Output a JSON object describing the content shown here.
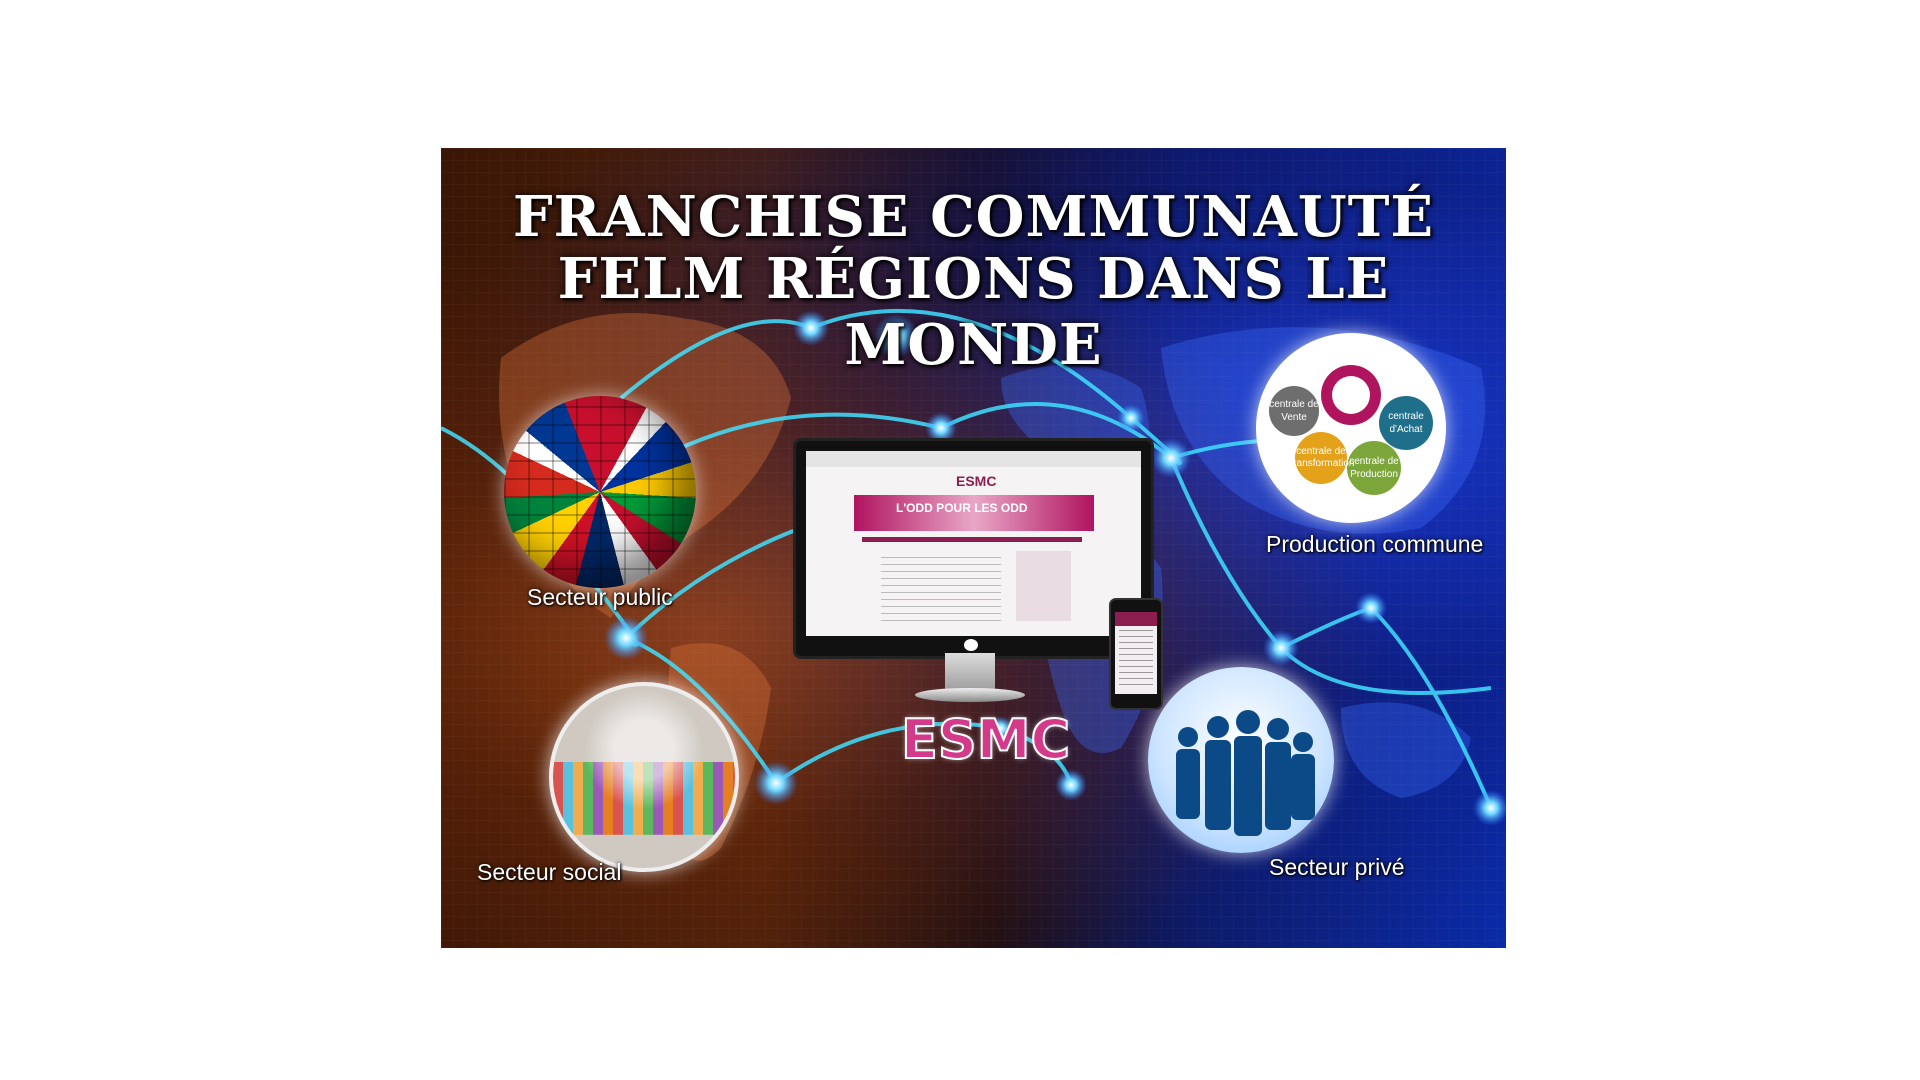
{
  "poster": {
    "title_line1": "FRANCHISE COMMUNAUTÉ",
    "title_line2": "FELM RÉGIONS DANS LE MONDE",
    "brand": "ESMC",
    "labels": {
      "public": "Secteur public",
      "social": "Secteur social",
      "private": "Secteur privé",
      "production": "Production commune"
    },
    "production_segments": [
      {
        "small": "centrale de",
        "big": "Vente"
      },
      {
        "small": "centrale",
        "big": "d'Achat"
      },
      {
        "small": "centrale de",
        "big": "Transformation"
      },
      {
        "small": "centrale de",
        "big": "Production"
      }
    ],
    "screen": {
      "site_title": "ESMC",
      "banner": "L'ODD POUR LES ODD"
    }
  },
  "colors": {
    "brand_pink": "#d43a8a",
    "line_cyan": "#3fe0ff"
  }
}
